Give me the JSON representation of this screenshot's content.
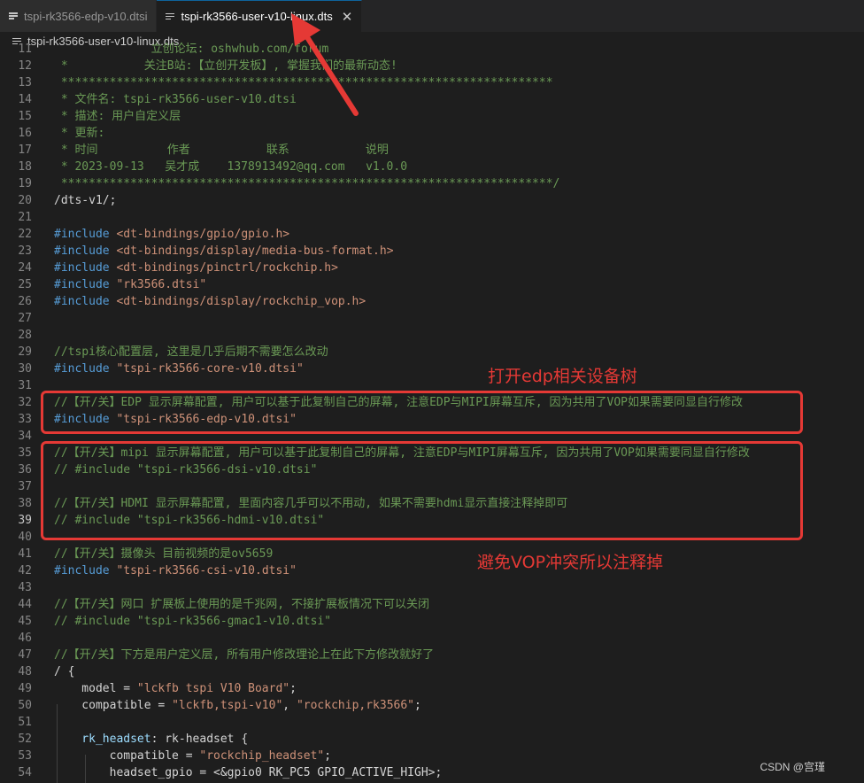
{
  "tabs": [
    {
      "label": "tspi-rk3566-edp-v10.dtsi",
      "active": false
    },
    {
      "label": "tspi-rk3566-user-v10-linux.dts",
      "active": true
    }
  ],
  "breadcrumb": "tspi-rk3566-user-v10-linux.dts",
  "lines": [
    {
      "n": "11",
      "parts": [
        [
          "c-comment",
          "              立创论坛: oshwhub.com/forum"
        ]
      ]
    },
    {
      "n": "12",
      "parts": [
        [
          "c-comment",
          " *           关注B站:【立创开发板】, 掌握我们的最新动态!"
        ]
      ]
    },
    {
      "n": "13",
      "parts": [
        [
          "c-comment",
          " ***********************************************************************"
        ]
      ]
    },
    {
      "n": "14",
      "parts": [
        [
          "c-comment",
          " * 文件名: tspi-rk3566-user-v10.dtsi"
        ]
      ]
    },
    {
      "n": "15",
      "parts": [
        [
          "c-comment",
          " * 描述: 用户自定义层"
        ]
      ]
    },
    {
      "n": "16",
      "parts": [
        [
          "c-comment",
          " * 更新:"
        ]
      ]
    },
    {
      "n": "17",
      "parts": [
        [
          "c-comment",
          " * 时间          作者           联系           说明"
        ]
      ]
    },
    {
      "n": "18",
      "parts": [
        [
          "c-comment",
          " * 2023-09-13   吴才成    1378913492@qq.com   v1.0.0"
        ]
      ]
    },
    {
      "n": "19",
      "parts": [
        [
          "c-comment",
          " ***********************************************************************/"
        ]
      ]
    },
    {
      "n": "20",
      "parts": [
        [
          "c-plain",
          "/dts-v1/;"
        ]
      ]
    },
    {
      "n": "21",
      "parts": []
    },
    {
      "n": "22",
      "parts": [
        [
          "c-kw",
          "#include "
        ],
        [
          "c-str",
          "<dt-bindings/gpio/gpio.h>"
        ]
      ]
    },
    {
      "n": "23",
      "parts": [
        [
          "c-kw",
          "#include "
        ],
        [
          "c-str",
          "<dt-bindings/display/media-bus-format.h>"
        ]
      ]
    },
    {
      "n": "24",
      "parts": [
        [
          "c-kw",
          "#include "
        ],
        [
          "c-str",
          "<dt-bindings/pinctrl/rockchip.h>"
        ]
      ]
    },
    {
      "n": "25",
      "parts": [
        [
          "c-kw",
          "#include "
        ],
        [
          "c-str",
          "\"rk3566.dtsi\""
        ]
      ]
    },
    {
      "n": "26",
      "parts": [
        [
          "c-kw",
          "#include "
        ],
        [
          "c-str",
          "<dt-bindings/display/rockchip_vop.h>"
        ]
      ]
    },
    {
      "n": "27",
      "parts": []
    },
    {
      "n": "28",
      "parts": []
    },
    {
      "n": "29",
      "parts": [
        [
          "c-comment",
          "//tspi核心配置层, 这里是几乎后期不需要怎么改动"
        ]
      ]
    },
    {
      "n": "30",
      "parts": [
        [
          "c-kw",
          "#include "
        ],
        [
          "c-str",
          "\"tspi-rk3566-core-v10.dtsi\""
        ]
      ]
    },
    {
      "n": "31",
      "parts": []
    },
    {
      "n": "32",
      "parts": [
        [
          "c-comment",
          "//【开/关】EDP 显示屏幕配置, 用户可以基于此复制自己的屏幕, 注意EDP与MIPI屏幕互斥, 因为共用了VOP如果需要同显自行修改"
        ]
      ]
    },
    {
      "n": "33",
      "parts": [
        [
          "c-kw",
          "#include "
        ],
        [
          "c-str",
          "\"tspi-rk3566-edp-v10.dtsi\""
        ]
      ]
    },
    {
      "n": "34",
      "parts": []
    },
    {
      "n": "35",
      "parts": [
        [
          "c-comment",
          "//【开/关】mipi 显示屏幕配置, 用户可以基于此复制自己的屏幕, 注意EDP与MIPI屏幕互斥, 因为共用了VOP如果需要同显自行修改"
        ]
      ]
    },
    {
      "n": "36",
      "parts": [
        [
          "c-comment",
          "// #include \"tspi-rk3566-dsi-v10.dtsi\""
        ]
      ]
    },
    {
      "n": "37",
      "parts": []
    },
    {
      "n": "38",
      "parts": [
        [
          "c-comment",
          "//【开/关】HDMI 显示屏幕配置, 里面内容几乎可以不用动, 如果不需要hdmi显示直接注释掉即可"
        ]
      ]
    },
    {
      "n": "39",
      "parts": [
        [
          "c-comment",
          "// #include \"tspi-rk3566-hdmi-v10.dtsi\""
        ]
      ]
    },
    {
      "n": "40",
      "parts": []
    },
    {
      "n": "41",
      "parts": [
        [
          "c-comment",
          "//【开/关】摄像头 目前视频的是ov5659"
        ]
      ]
    },
    {
      "n": "42",
      "parts": [
        [
          "c-kw",
          "#include "
        ],
        [
          "c-str",
          "\"tspi-rk3566-csi-v10.dtsi\""
        ]
      ]
    },
    {
      "n": "43",
      "parts": []
    },
    {
      "n": "44",
      "parts": [
        [
          "c-comment",
          "//【开/关】网口 扩展板上使用的是千兆网, 不接扩展板情况下可以关闭"
        ]
      ]
    },
    {
      "n": "45",
      "parts": [
        [
          "c-comment",
          "// #include \"tspi-rk3566-gmac1-v10.dtsi\""
        ]
      ]
    },
    {
      "n": "46",
      "parts": []
    },
    {
      "n": "47",
      "parts": [
        [
          "c-comment",
          "//【开/关】下方是用户定义层, 所有用户修改理论上在此下方修改就好了"
        ]
      ]
    },
    {
      "n": "48",
      "parts": [
        [
          "c-plain",
          "/ {"
        ]
      ]
    },
    {
      "n": "49",
      "parts": [
        [
          "c-plain",
          "    model = "
        ],
        [
          "c-str",
          "\"lckfb tspi V10 Board\""
        ],
        [
          "c-plain",
          ";"
        ]
      ]
    },
    {
      "n": "50",
      "parts": [
        [
          "c-plain",
          "    compatible = "
        ],
        [
          "c-str",
          "\"lckfb,tspi-v10\""
        ],
        [
          "c-plain",
          ", "
        ],
        [
          "c-str",
          "\"rockchip,rk3566\""
        ],
        [
          "c-plain",
          ";"
        ]
      ]
    },
    {
      "n": "51",
      "parts": []
    },
    {
      "n": "52",
      "parts": [
        [
          "c-label",
          "    rk_headset"
        ],
        [
          "c-plain",
          ": rk-headset {"
        ]
      ]
    },
    {
      "n": "53",
      "parts": [
        [
          "c-plain",
          "        compatible = "
        ],
        [
          "c-str",
          "\"rockchip_headset\""
        ],
        [
          "c-plain",
          ";"
        ]
      ]
    },
    {
      "n": "54",
      "parts": [
        [
          "c-plain",
          "        headset_gpio = <&gpio0 RK_PC5 GPIO_ACTIVE_HIGH>;"
        ]
      ]
    }
  ],
  "current_line": "39",
  "annotations": {
    "open_edp": "打开edp相关设备树",
    "avoid_vop": "避免VOP冲突所以注释掉"
  },
  "watermark": "CSDN @宫瑾",
  "colors": {
    "highlight": "#e53935",
    "comment": "#6a9955",
    "keyword": "#569cd6",
    "string": "#ce9178"
  }
}
